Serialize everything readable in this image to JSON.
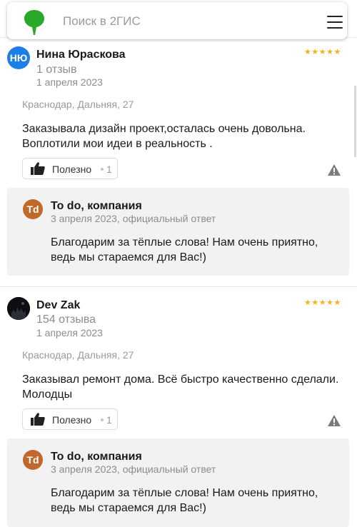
{
  "search": {
    "placeholder": "Поиск в 2ГИС"
  },
  "colors": {
    "brand_green": "#29a829",
    "star": "#f5b21b",
    "company_avatar": "#c0692a",
    "avatar_blue": "#1e7ee8"
  },
  "reviews": [
    {
      "avatar_initials": "НЮ",
      "author": "Нина Юраскова",
      "count": "1 отзыв",
      "date": "1 апреля 2023",
      "stars": "★★★★★",
      "rating": 5,
      "address": "Краснодар, Дальняя, 27",
      "text": "Заказывала дизайн проект,осталась очень довольна. Воплотили мои идеи в реальность .",
      "useful_label": "Полезно",
      "useful_count": "1",
      "reply": {
        "avatar_initials": "Td",
        "company": "To do, компания",
        "meta": "3 апреля 2023, официальный ответ",
        "text": "Благодарим за тёплые слова! Нам очень приятно, ведь мы стараемся для Вас!)"
      }
    },
    {
      "avatar_initials": "",
      "author": "Dev Zak",
      "count": "154 отзыва",
      "date": "1 апреля 2023",
      "stars": "★★★★★",
      "rating": 5,
      "address": "Краснодар, Дальняя, 27",
      "text": "Заказывал ремонт дома. Всё быстро качественно сделали. Молодцы",
      "useful_label": "Полезно",
      "useful_count": "1",
      "reply": {
        "avatar_initials": "Td",
        "company": "To do, компания",
        "meta": "3 апреля 2023, официальный ответ",
        "text": "Благодарим за тёплые слова! Нам очень приятно, ведь мы стараемся для Вас!)"
      }
    }
  ]
}
